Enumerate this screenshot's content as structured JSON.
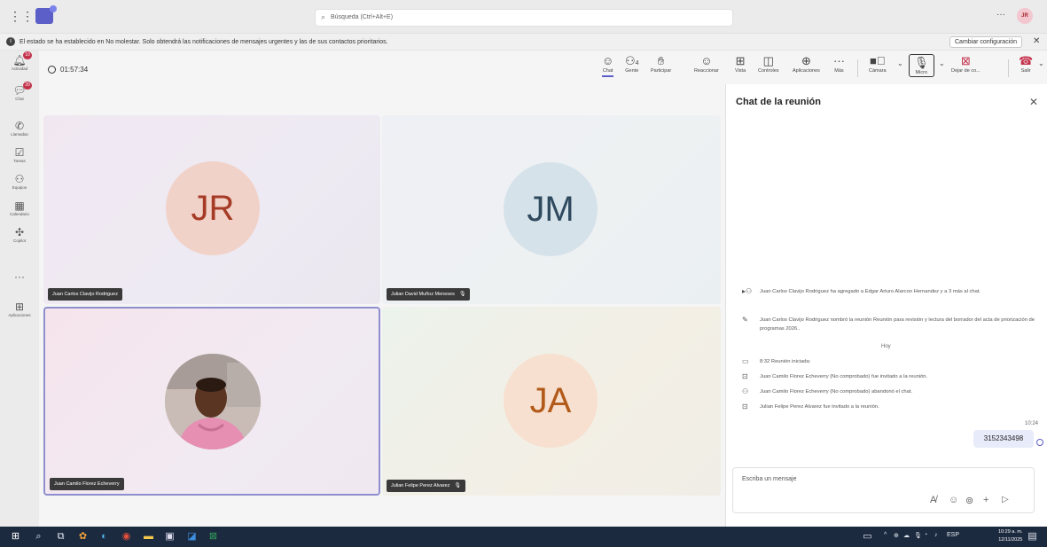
{
  "topbar": {
    "search_placeholder": "Búsqueda (Ctrl+Alt+E)",
    "more": "···",
    "avatar_initials": "JR"
  },
  "banner": {
    "text": "El estado se ha establecido en No molestar. Solo obtendrá las notificaciones de mensajes urgentes y las de sus contactos prioritarios.",
    "config_button": "Cambiar configuración"
  },
  "rail": [
    {
      "label": "Actividad",
      "icon": "bell-icon",
      "badge": "10"
    },
    {
      "label": "Chat",
      "icon": "chat-icon",
      "badge": "20"
    },
    {
      "label": "Llamadas",
      "icon": "phone-icon"
    },
    {
      "label": "Tareas",
      "icon": "tasks-icon"
    },
    {
      "label": "Equipos",
      "icon": "teams-icon"
    },
    {
      "label": "Calendario",
      "icon": "calendar-icon"
    },
    {
      "label": "Copilot",
      "icon": "copilot-icon"
    },
    {
      "label": "",
      "icon": "more-icon"
    },
    {
      "label": "Aplicaciones",
      "icon": "apps-icon"
    }
  ],
  "meeting": {
    "timer": "01:57:34",
    "toolbar": {
      "chat": "Chat",
      "people": "Gente",
      "people_count": "4",
      "raise": "Participar",
      "react": "Reaccionar",
      "view": "Vista",
      "controls": "Controles",
      "apps": "Aplicaciones",
      "more": "Más",
      "camera": "Cámara",
      "mic": "Micro",
      "share": "Dejar de co...",
      "leave": "Salir"
    },
    "participants": [
      {
        "name": "Juan Carlos Clavijo Rodriguez",
        "initials": "JR"
      },
      {
        "name": "Julian David Muñoz Meneses",
        "initials": "JM"
      },
      {
        "name": "Juan Camilo Florez Echeverry",
        "initials": ""
      },
      {
        "name": "Julian Felipe Perez Alvarez",
        "initials": "JA"
      }
    ]
  },
  "chat": {
    "title": "Chat de la reunión",
    "messages": [
      "Juan Carlos Clavijo Rodriguez ha agregado a Edgar Arturo Alarcon Hernandez y a 3 más al chat.",
      "Juan Carlos Clavijo Rodriguez nombró la reunión Reunión para revisión y lectura del borrador del acta de priorización de programas 2026..",
      "8:32   Reunión iniciada:",
      "Juan Camilo Florez Echeverry (No comprobado) fue invitado a la reunión.",
      "Juan Camilo Florez Echeverry (No comprobado) abandonó el chat.",
      "Julian Felipe Perez Alvarez fue invitado a la reunión."
    ],
    "day_label": "Hoy",
    "my_message_time": "10:24",
    "my_message": "3152343498",
    "compose_placeholder": "Escriba un mensaje"
  },
  "taskbar": {
    "lang": "ESP",
    "time": "10:29 a. m.",
    "date": "12/11/2025"
  }
}
